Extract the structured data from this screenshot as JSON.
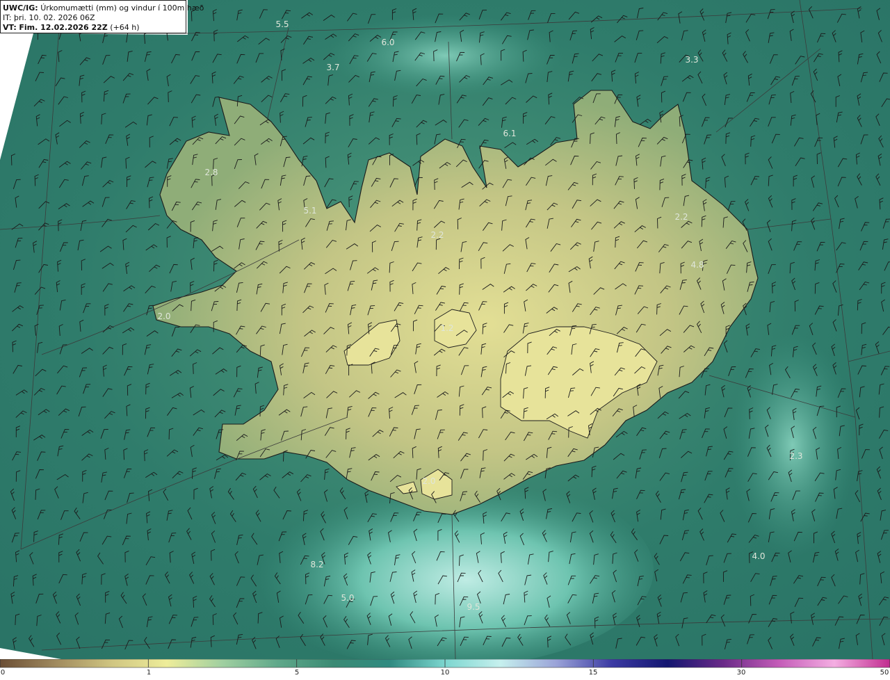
{
  "header": {
    "model": "UWC/IG:",
    "title": "Úrkomumætti (mm) og vindur í 100m hæð",
    "it_label": "IT:",
    "it_value": "þri. 10. 02. 2026 06Z",
    "vt_label": "VT:",
    "vt_value": "Fim. 12.02.2026 22Z",
    "lead": "(+64 h)"
  },
  "map_labels": [
    "5.5",
    "6.0",
    "3.7",
    "3.3",
    "6.1",
    "2.8",
    "5.1",
    "2.2",
    "2.2",
    "4.8",
    "2.0",
    "1.2",
    "2.3",
    "2.0",
    "8.2",
    "4.0",
    "5.0",
    "9.5"
  ],
  "colorbar": {
    "ticks": [
      "0",
      "1",
      "5",
      "10",
      "15",
      "30",
      "50"
    ],
    "values": [
      0,
      1,
      5,
      10,
      15,
      30,
      50
    ],
    "colors": [
      "#6b4e35",
      "#a08a5e",
      "#cfc581",
      "#eeed9a",
      "#9fcfa0",
      "#5fa88a",
      "#3b8a74",
      "#2f8a80",
      "#7cd6cf",
      "#c6f0ee",
      "#9aa3d8",
      "#3b3aa3",
      "#131670",
      "#6a2a88",
      "#c45cb8",
      "#f4aee2",
      "#c12b8f"
    ]
  },
  "colors": {
    "sea": "#2f7c6b",
    "land": "#b8be7e",
    "highland": "#dcd98f",
    "coast_line": "#1b1b1b",
    "grid_line": "#3b3b3b"
  }
}
